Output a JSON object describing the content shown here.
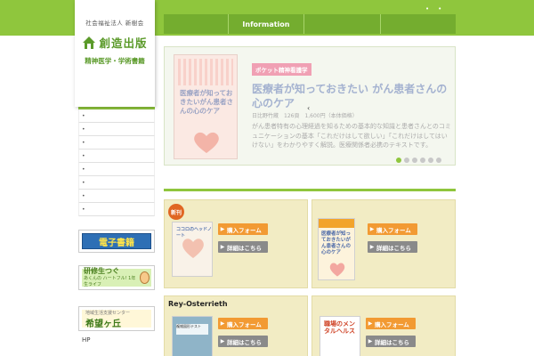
{
  "header": {
    "org": "社会福祉法人 新樹会",
    "brand": "創造出版",
    "tagline": "精神医学・学術書籍",
    "nav": [
      "Information",
      "",
      "",
      ""
    ],
    "top_dots": [
      "•",
      "•"
    ]
  },
  "slider": {
    "book_text": "医療者が知っておきたいがん患者さんの心のケア",
    "badge": "ポケット精神看護学",
    "title": "医療者が知っておきたい がん患者さんの心のケア",
    "meta": "日比野竹蔵　126頁　1,600円（本体価格）",
    "desc": "がん患者特有の心理経過を知るための基本的な知識と患者さんとのコミュニケーションの基本「これだけはして欲しい」「これだけはしてはいけない」をわかりやすく解説。医療関係者必携のテキストです。",
    "arrow": "‹",
    "pages": 6,
    "active_page": 0
  },
  "sidebar": {
    "head": "■",
    "items": [
      "•",
      "•",
      "•",
      "•",
      "•",
      "•",
      "•",
      "•"
    ],
    "banner1": "電子書籍",
    "banner2_title": "研修生つぐ",
    "banner2_sub": "あくんの ハートフル! 1年生ライフ",
    "banner3_sub": "地域生活支援センター",
    "banner3_main": "希望ヶ丘",
    "hp_label": "HP"
  },
  "cards": [
    {
      "badge": "新刊",
      "title": "",
      "cover_text": "ココロのヘッドノート",
      "buy_label": "購入フォーム",
      "detail_label": "詳細はこちら"
    },
    {
      "badge": "",
      "title": "",
      "cover_text": "医療者が知っておきたいがん患者さんの心のケア",
      "buy_label": "購入フォーム",
      "detail_label": "詳細はこちら"
    },
    {
      "badge": "",
      "title": "Rey-Osterrieth",
      "cover_text": "複雑図形テスト",
      "buy_label": "購入フォーム",
      "detail_label": "詳細はこちら"
    },
    {
      "badge": "",
      "title": "",
      "cover_text": "職場のメンタルヘルス",
      "buy_label": "購入フォーム",
      "detail_label": "詳細はこちら"
    }
  ],
  "colors": {
    "brand_green": "#8fc63d",
    "nav_green": "#74ad2f",
    "card_bg": "#f2ecc4",
    "buy_orange": "#f29a33",
    "detail_gray": "#8a8a8a"
  }
}
